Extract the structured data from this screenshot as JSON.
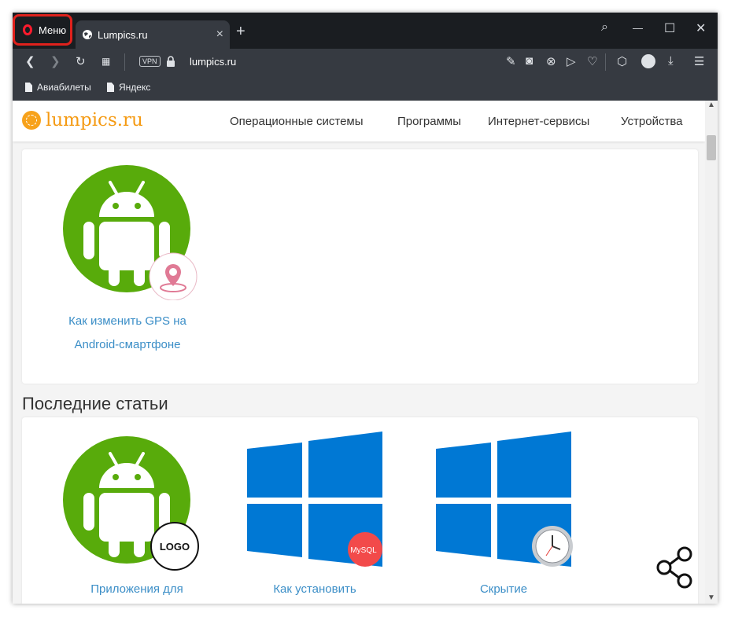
{
  "browser": {
    "menu_label": "Меню",
    "tab_title": "Lumpics.ru",
    "tab_close": "×",
    "new_tab": "+",
    "vpn_label": "VPN",
    "url": "lumpics.ru",
    "window_controls": {
      "search": "⌕",
      "minimize": "—",
      "maximize": "☐",
      "close": "✕"
    },
    "bookmarks": [
      "Авиабилеты",
      "Яндекс"
    ]
  },
  "site": {
    "logo_text": "lumpics.ru",
    "nav": [
      "Операционные системы",
      "Программы",
      "Интернет-сервисы",
      "Устройства"
    ],
    "featured": {
      "line1": "Как изменить GPS на",
      "line2": "Android-смартфоне"
    },
    "section_title": "Последние статьи",
    "articles": [
      {
        "title": "Приложения для",
        "badge": "LOGO"
      },
      {
        "title": "Как установить",
        "badge": "MySQL"
      },
      {
        "title": "Скрытие",
        "badge": ""
      }
    ]
  },
  "colors": {
    "android_green": "#58ab0b",
    "windows_blue": "#0078d4",
    "link": "#3b8ec7",
    "menu_highlight": "#e0211c"
  }
}
